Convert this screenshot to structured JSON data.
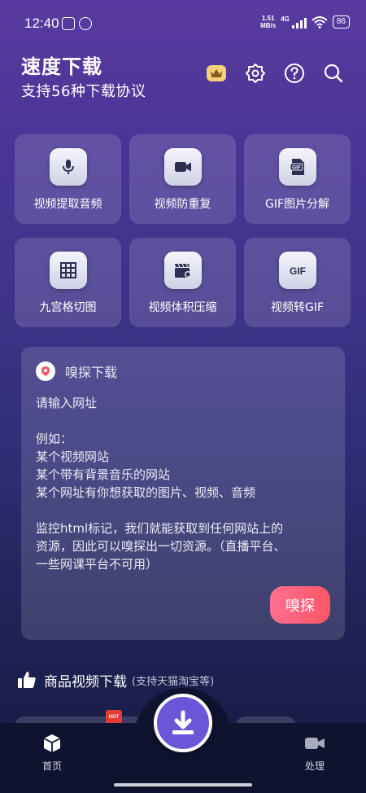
{
  "status_bar": {
    "time": "12:40",
    "net_speed_value": "1.51",
    "net_speed_unit": "MB/s",
    "network_type": "4G",
    "battery": "86"
  },
  "header": {
    "title": "速度下载",
    "subtitle": "支持56种下载协议",
    "icons": [
      "vip-crown-icon",
      "settings-gear-icon",
      "help-question-icon",
      "search-icon"
    ]
  },
  "tools": [
    {
      "label": "视频提取音频",
      "icon": "microphone-icon"
    },
    {
      "label": "视频防重复",
      "icon": "video-camera-icon"
    },
    {
      "label": "GIF图片分解",
      "icon": "gif-file-icon"
    },
    {
      "label": "九宫格切图",
      "icon": "grid-icon"
    },
    {
      "label": "视频体积压缩",
      "icon": "clapperboard-icon"
    },
    {
      "label": "视频转GIF",
      "icon": "gif-icon"
    }
  ],
  "tool_icon_text": {
    "gif_file": "GIF",
    "gif": "GIF"
  },
  "sniff": {
    "title": "嗅探下载",
    "placeholder": "请输入网址",
    "example_head": "例如：",
    "examples": [
      "某个视频网站",
      "某个带有背景音乐的网站",
      "某个网址有你想获取的图片、视频、音频"
    ],
    "desc_lines": [
      "监控html标记，我们就能获取到任何网站上的",
      "资源，因此可以嗅探出一切资源。（直播平台、",
      "一些网课平台不可用）"
    ],
    "button": "嗅探"
  },
  "product": {
    "title": "商品视频下载",
    "note": "(支持天猫淘宝等)",
    "badge": "HOT"
  },
  "nav": {
    "home": "首页",
    "process": "处理"
  },
  "colors": {
    "accent": "#6b55d9",
    "sniff_button": "#ff5f77",
    "nav_bg": "#0e1330"
  }
}
